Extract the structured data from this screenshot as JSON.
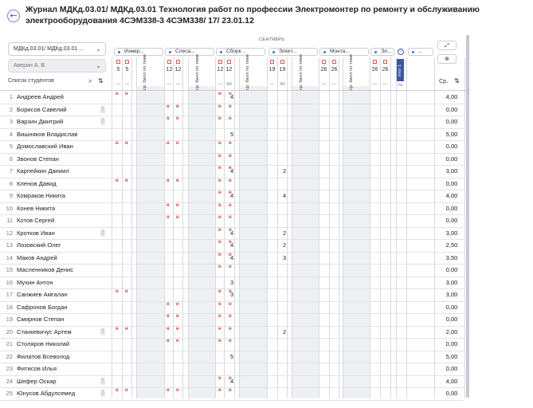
{
  "header": {
    "back_icon": "arrow-left-icon",
    "title": "Журнал МДКд.03.01/ МДКд.03.01 Технология работ по профессии Электромонтер по ремонту и обслуживанию электрооборудования 4СЭМ338-3 4СЭМ338/ 17/ 23.01.12"
  },
  "filters": {
    "subject": "МДКд.03.01/ МДКд.03.01 ...",
    "teacher": "Аверин А. В."
  },
  "list_label": "Список студентов",
  "calendar": {
    "month": "СЕНТЯБРЬ",
    "groups": [
      "Измер...",
      "Слеса...",
      "Сборк...",
      "Элект...",
      "Монта...",
      "Эл...",
      "..."
    ],
    "dates": [
      "5",
      "5",
      "12",
      "12",
      "12",
      "12",
      "19",
      "19",
      "26",
      "26",
      "26",
      "26"
    ],
    "avg_header": "ср. балл по теме",
    "uo": "УО",
    "itog": "итог 1",
    "itog_sub": "ба",
    "avg_col": "Ср."
  },
  "students": [
    {
      "n": "1",
      "name": "Андреев Андрей",
      "avg": "4,00"
    },
    {
      "n": "2",
      "name": "Борисов Савелий",
      "avg": "0,00"
    },
    {
      "n": "3",
      "name": "Варзин Дмитрий",
      "avg": "0,00"
    },
    {
      "n": "4",
      "name": "Вишняков Владислав",
      "avg": "5,00"
    },
    {
      "n": "5",
      "name": "Домославский Иван",
      "avg": "0,00"
    },
    {
      "n": "6",
      "name": "Звонов Степан",
      "avg": "0,00"
    },
    {
      "n": "7",
      "name": "Карпейкин Даниил",
      "avg": "3,00"
    },
    {
      "n": "8",
      "name": "Кленов Давид",
      "avg": "0,00"
    },
    {
      "n": "9",
      "name": "Комраков Никита",
      "avg": "4,00"
    },
    {
      "n": "10",
      "name": "Конев Никита",
      "avg": "0,00"
    },
    {
      "n": "11",
      "name": "Котов Сергей",
      "avg": "0,00"
    },
    {
      "n": "12",
      "name": "Кротков Иван",
      "avg": "3,00"
    },
    {
      "n": "13",
      "name": "Лозовский Олег",
      "avg": "2,50"
    },
    {
      "n": "14",
      "name": "Маков Андрей",
      "avg": "3,50"
    },
    {
      "n": "15",
      "name": "Масленников Денис",
      "avg": "0,00"
    },
    {
      "n": "16",
      "name": "Мухин Антон",
      "avg": "3,00"
    },
    {
      "n": "17",
      "name": "Санжиев Амгалан",
      "avg": "3,00"
    },
    {
      "n": "18",
      "name": "Сафронов Богдан",
      "avg": "0,00"
    },
    {
      "n": "19",
      "name": "Смирнов Степан",
      "avg": "0,00"
    },
    {
      "n": "20",
      "name": "Станкевичус Артем",
      "avg": "2,00"
    },
    {
      "n": "21",
      "name": "Столяров Николай",
      "avg": "0,00"
    },
    {
      "n": "22",
      "name": "Филатов Всеволод",
      "avg": "5,00"
    },
    {
      "n": "23",
      "name": "Фитисов Илья",
      "avg": "0,00"
    },
    {
      "n": "24",
      "name": "Шефер Оскар",
      "avg": "4,00"
    },
    {
      "n": "25",
      "name": "Юнусов Абдулсемед",
      "avg": "0,00"
    }
  ],
  "grades": {
    "col_uo": [
      "4",
      "",
      "",
      "5",
      "",
      "",
      "4",
      "",
      "4",
      "",
      "",
      "4",
      "4",
      "4",
      "",
      "3",
      "3",
      "",
      "",
      "",
      "",
      "5",
      "",
      "4",
      ""
    ],
    "col_19": [
      "",
      "",
      "",
      "",
      "",
      "",
      "2",
      "",
      "4",
      "",
      "",
      "2",
      "2",
      "3",
      "",
      "",
      "",
      "",
      "",
      "2",
      "",
      "",
      "",
      "",
      ""
    ]
  },
  "marks": {
    "absent_symbol": "н",
    "rows_a": [
      2,
      3,
      5,
      8,
      10,
      11,
      18,
      19,
      20,
      21,
      25
    ],
    "rows_b": [
      1,
      5,
      8,
      17,
      20,
      25
    ],
    "rows_c": [
      1,
      2,
      3,
      5,
      6,
      7,
      8,
      9,
      10,
      11,
      12,
      13,
      14,
      15,
      17,
      18,
      19,
      20,
      21,
      24,
      25
    ]
  },
  "buttons": {
    "expand_icon": "expand-icon",
    "zoom_icon": "zoom-in-icon",
    "search_icon": "search-icon",
    "sort_icon": "sort-icon",
    "more_label": "⋮"
  }
}
